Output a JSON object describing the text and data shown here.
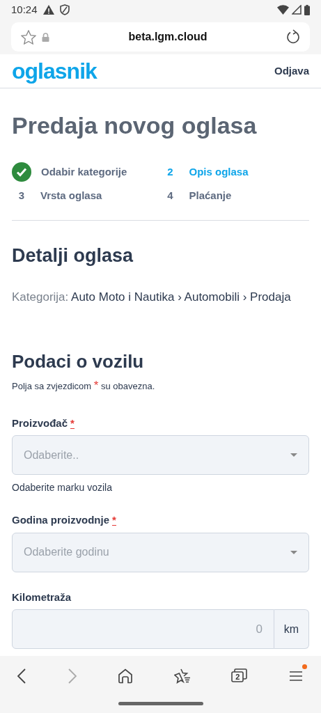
{
  "status_bar": {
    "time": "10:24"
  },
  "browser": {
    "url": "beta.lgm.cloud",
    "tab_count": "2",
    "forward_disabled": true,
    "menu_notification": true
  },
  "header": {
    "logo": "oglasnik",
    "logout": "Odjava"
  },
  "page_title": "Predaja novog oglasa",
  "steps": [
    {
      "label": "Odabir kategorije",
      "done": true,
      "selected": false
    },
    {
      "number": "2",
      "label": "Opis oglasa",
      "done": false,
      "selected": true
    },
    {
      "number": "3",
      "label": "Vrsta oglasa",
      "done": false,
      "selected": false
    },
    {
      "number": "4",
      "label": "Plaćanje",
      "done": false,
      "selected": false
    }
  ],
  "section_title": "Detalji oglasa",
  "category": {
    "label": "Kategorija:",
    "path": "Auto Moto i Nautika › Automobili › Prodaja"
  },
  "form": {
    "title": "Podaci o vozilu",
    "note_before": "Polja sa zvjezdicom",
    "note_mark": "*",
    "note_after": "su obavezna.",
    "fields": [
      {
        "kind": "select",
        "label": "Proizvođač",
        "required": true,
        "placeholder": "Odaberite..",
        "help": "Odaberite marku vozila"
      },
      {
        "kind": "select",
        "label": "Godina proizvodnje",
        "required": true,
        "placeholder": "Odaberite godinu"
      },
      {
        "kind": "number",
        "label": "Kilometraža",
        "required": false,
        "placeholder": "0",
        "unit": "km"
      }
    ]
  }
}
